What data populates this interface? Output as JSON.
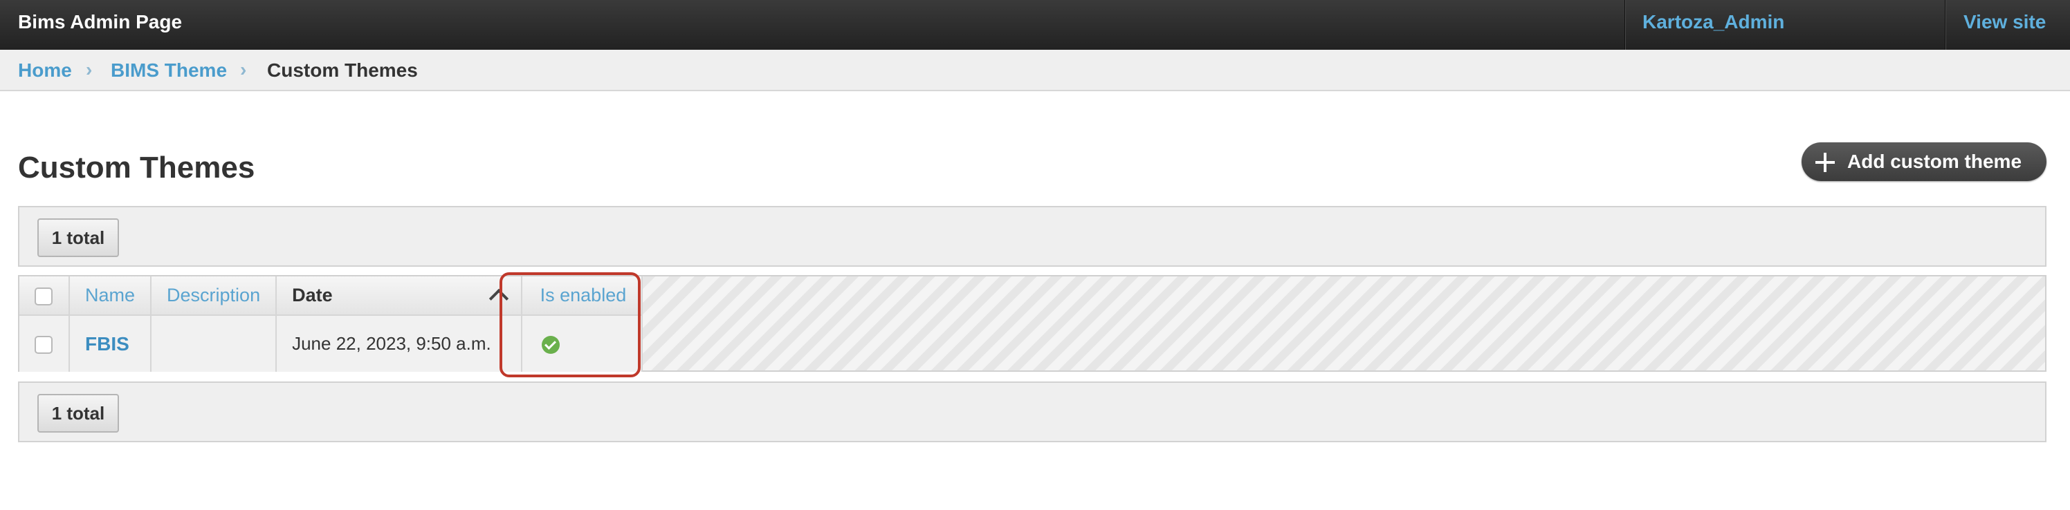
{
  "header": {
    "brand": "Bims Admin Page",
    "user": "Kartoza_Admin",
    "view_site": "View site"
  },
  "breadcrumb": {
    "items": [
      "Home",
      "BIMS Theme"
    ],
    "current": "Custom Themes",
    "separator": "›"
  },
  "page": {
    "title": "Custom Themes",
    "add_button": "Add custom theme"
  },
  "paginator": {
    "top_label": "1 total",
    "bottom_label": "1 total"
  },
  "table": {
    "columns": [
      "Name",
      "Description",
      "Date",
      "Is enabled"
    ],
    "sorted_column": "Date",
    "rows": [
      {
        "name": "FBIS",
        "description": "",
        "date": "June 22, 2023, 9:50 a.m.",
        "is_enabled": "yes-icon"
      }
    ]
  },
  "colors": {
    "link": "#4a9ccc",
    "header_bg": "#2b2b2b",
    "enabled_icon": "#6ab04c",
    "highlight_border": "#c0392b"
  }
}
